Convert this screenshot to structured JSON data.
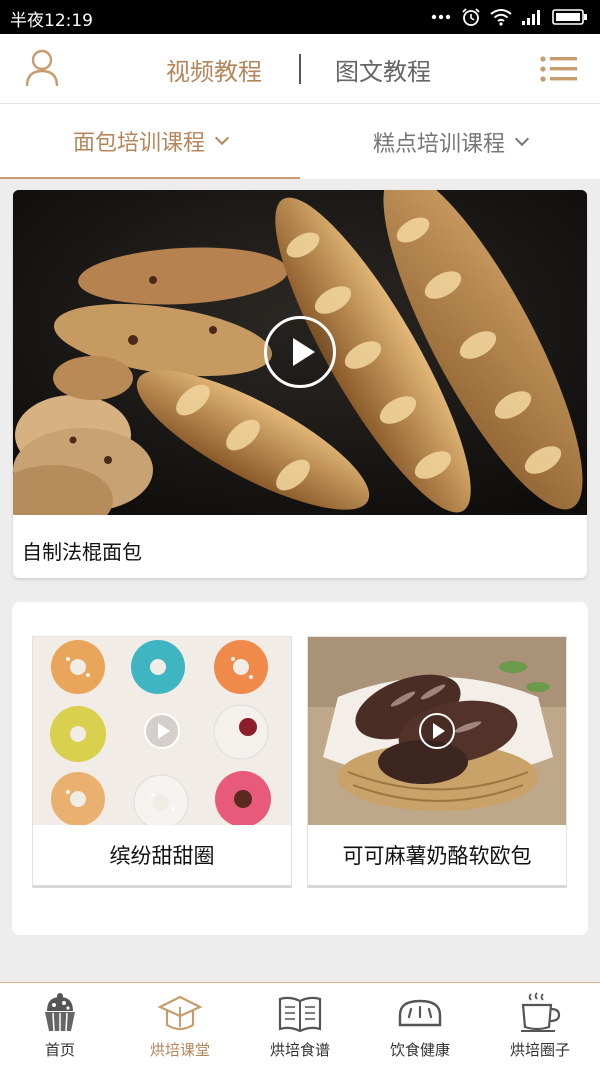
{
  "status_bar": {
    "time": "半夜12:19"
  },
  "top_nav": {
    "tabs": [
      {
        "label": "视频教程",
        "active": true
      },
      {
        "label": "图文教程",
        "active": false
      }
    ],
    "accent_color": "#b5865a"
  },
  "sub_nav": {
    "items": [
      {
        "label": "面包培训课程",
        "active": true
      },
      {
        "label": "糕点培训课程",
        "active": false
      }
    ]
  },
  "featured": {
    "title": "自制法棍面包",
    "image": "baguette-photo",
    "icon": "play-icon"
  },
  "videos": [
    {
      "title": "缤纷甜甜圈",
      "image": "donuts-photo",
      "icon": "play-icon"
    },
    {
      "title": "可可麻薯奶酪软欧包",
      "image": "cocoa-bread-photo",
      "icon": "play-icon"
    }
  ],
  "tab_bar": {
    "items": [
      {
        "label": "首页",
        "icon": "cupcake-icon",
        "active": false
      },
      {
        "label": "烘培课堂",
        "icon": "graduation-cap-icon",
        "active": true
      },
      {
        "label": "烘培食谱",
        "icon": "recipe-book-icon",
        "active": false
      },
      {
        "label": "饮食健康",
        "icon": "bread-loaf-icon",
        "active": false
      },
      {
        "label": "烘培圈子",
        "icon": "coffee-cup-icon",
        "active": false
      }
    ]
  }
}
